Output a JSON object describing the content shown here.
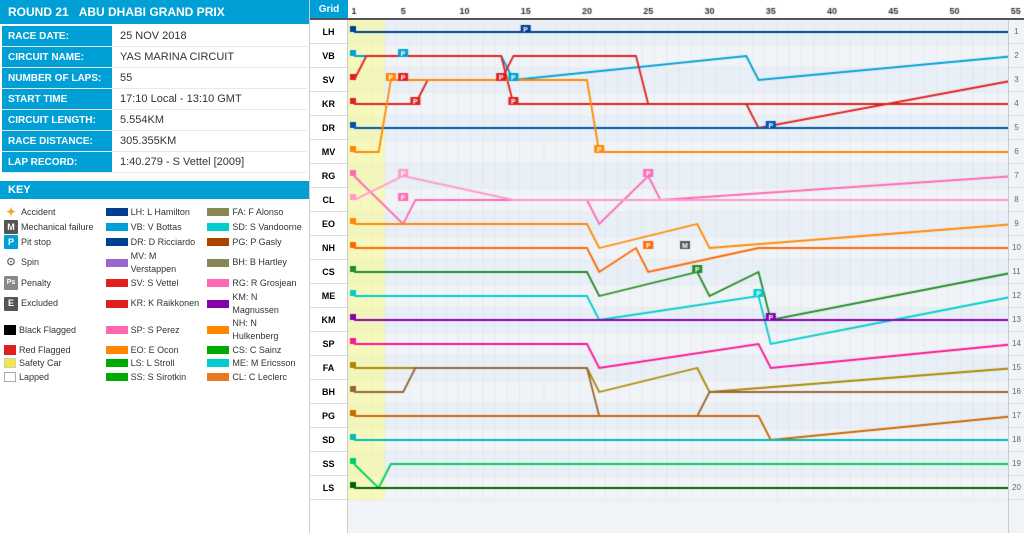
{
  "left": {
    "round_label": "ROUND 21",
    "race_name": "ABU DHABI GRAND PRIX",
    "race_date_label": "RACE DATE:",
    "race_date_value": "25 NOV 2018",
    "circuit_label": "CIRCUIT NAME:",
    "circuit_value": "YAS MARINA CIRCUIT",
    "laps_label": "NUMBER OF LAPS:",
    "laps_value": "55",
    "start_time_label": "START TIME",
    "start_time_value": "17:10 Local - 13:10 GMT",
    "circuit_length_label": "CIRCUIT LENGTH:",
    "circuit_length_value": "5.554KM",
    "race_distance_label": "RACE DISTANCE:",
    "race_distance_value": "305.355KM",
    "lap_record_label": "LAP RECORD:",
    "lap_record_value": "1:40.279 - S Vettel [2009]",
    "key_header": "KEY"
  },
  "chart": {
    "grid_label": "Grid",
    "lap_marks": [
      1,
      5,
      10,
      15,
      20,
      25,
      30,
      35,
      40,
      45,
      50,
      55
    ],
    "total_laps": 55,
    "rows": 20,
    "drivers": [
      {
        "pos": 1,
        "abbr": "LH",
        "color": "#003f8f",
        "finish": 1
      },
      {
        "pos": 2,
        "abbr": "VB",
        "color": "#e02020",
        "finish": 2
      },
      {
        "pos": 3,
        "abbr": "SV",
        "color": "#e02020",
        "finish": 3
      },
      {
        "pos": 4,
        "abbr": "KR",
        "color": "#e02020",
        "finish": 4
      },
      {
        "pos": 5,
        "abbr": "DR",
        "color": "#003f8f",
        "finish": 5
      },
      {
        "pos": 6,
        "abbr": "MV",
        "color": "#ff8800",
        "finish": 6
      },
      {
        "pos": 7,
        "abbr": "RG",
        "color": "#ff69b4",
        "finish": 7
      },
      {
        "pos": 8,
        "abbr": "CL",
        "color": "#ff69b4",
        "finish": 8
      },
      {
        "pos": 9,
        "abbr": "EO",
        "color": "#ff8800",
        "finish": 9
      },
      {
        "pos": 10,
        "abbr": "NH",
        "color": "#ff8800",
        "finish": 10
      },
      {
        "pos": 11,
        "abbr": "CS",
        "color": "#00aa00",
        "finish": 11
      },
      {
        "pos": 12,
        "abbr": "ME",
        "color": "#00cccc",
        "finish": 12
      },
      {
        "pos": 13,
        "abbr": "KM",
        "color": "#8800aa",
        "finish": 13
      },
      {
        "pos": 14,
        "abbr": "SP",
        "color": "#ff69b4",
        "finish": 14
      },
      {
        "pos": 15,
        "abbr": "FA",
        "color": "#888855",
        "finish": 15
      },
      {
        "pos": 16,
        "abbr": "BH",
        "color": "#888855",
        "finish": 16
      },
      {
        "pos": 17,
        "abbr": "PG",
        "color": "#aa4400",
        "finish": 17
      },
      {
        "pos": 18,
        "abbr": "SD",
        "color": "#00cccc",
        "finish": 18
      },
      {
        "pos": 19,
        "abbr": "SS",
        "color": "#00aa00",
        "finish": 19
      },
      {
        "pos": 20,
        "abbr": "LS",
        "color": "#00aa00",
        "finish": 20
      }
    ]
  }
}
